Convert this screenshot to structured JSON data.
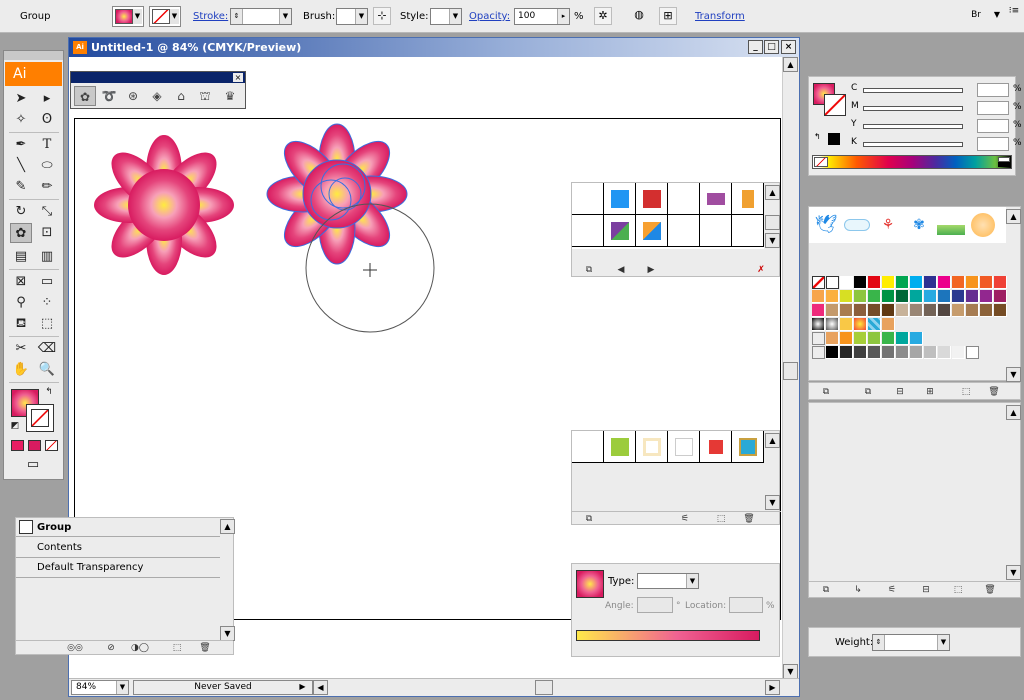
{
  "control_bar": {
    "selection_label": "Group",
    "stroke_label": "Stroke:",
    "brush_label": "Brush:",
    "style_label": "Style:",
    "opacity_label": "Opacity:",
    "opacity_value": "100",
    "opacity_unit": "%",
    "transform_label": "Transform"
  },
  "tools": {
    "logo_text": "Ai"
  },
  "document": {
    "title": "Untitled-1 @ 84% (CMYK/Preview)",
    "zoom_value": "84%",
    "save_status": "Never Saved"
  },
  "color_panel": {
    "channels": [
      {
        "label": "C",
        "value": "",
        "unit": "%"
      },
      {
        "label": "M",
        "value": "",
        "unit": "%"
      },
      {
        "label": "Y",
        "value": "",
        "unit": "%"
      },
      {
        "label": "K",
        "value": "",
        "unit": "%"
      }
    ]
  },
  "gradient_panel": {
    "type_label": "Type:",
    "type_value": "",
    "angle_label": "Angle:",
    "angle_unit": "°",
    "location_label": "Location:",
    "location_unit": "%"
  },
  "stroke_panel": {
    "weight_label": "Weight:",
    "weight_value": ""
  },
  "appearance_panel": {
    "header": "Group",
    "rows": [
      "Contents",
      "Default Transparency"
    ]
  },
  "colors": {
    "flower_edge": "#d81b60",
    "flower_center": "#ffec3d",
    "selection_blue": "#3a6fe0",
    "accent_orange": "#ff7f00"
  },
  "icons": {
    "toolbar_extra": [
      "puppet-icon",
      "recolor-icon",
      "align-icon",
      "bridge-icon",
      "panel-menu-icon"
    ]
  }
}
